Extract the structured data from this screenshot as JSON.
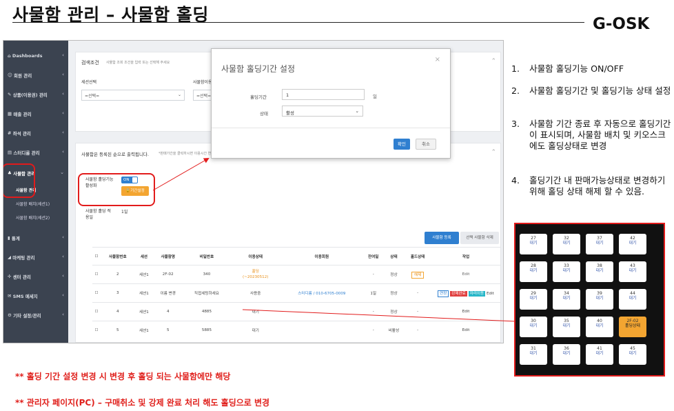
{
  "header": {
    "title": "사물함 관리 – 사물함 홀딩",
    "brand": "G-OSK"
  },
  "sidebar": {
    "items": [
      {
        "label": "Dashboards",
        "icon": "home-icon"
      },
      {
        "label": "회원 관리",
        "icon": "user-icon"
      },
      {
        "label": "상품(이용권) 관리",
        "icon": "tag-icon"
      },
      {
        "label": "매출 관리",
        "icon": "chart-icon"
      },
      {
        "label": "좌석 관리",
        "icon": "seat-icon"
      },
      {
        "label": "스터디룸 관리",
        "icon": "room-icon"
      },
      {
        "label": "사물함 관리",
        "icon": "locker-icon"
      },
      {
        "label": "통계",
        "icon": "stats-icon"
      },
      {
        "label": "마케팅 관리",
        "icon": "megaphone-icon"
      },
      {
        "label": "센터 관리",
        "icon": "center-icon"
      },
      {
        "label": "SMS 메세지",
        "icon": "sms-icon"
      },
      {
        "label": "기타 설정/관리",
        "icon": "settings-icon"
      }
    ],
    "subitems": [
      "사물함 관리",
      "사물함 배치(세션1)",
      "사물함 배치(세션2)"
    ]
  },
  "search": {
    "title": "검색조건",
    "hint": "사물함 조회 조건을 입력 또는 선택해 주세요",
    "labels": [
      "세션선택",
      "사물함이용상태",
      "상태"
    ],
    "placeholders": [
      "=선택=",
      "=선택="
    ]
  },
  "list": {
    "title": "사물함은 등록된 순으로 출력됩니다.",
    "hint": "*판매가간을 클릭하시면 이용시간 연장이",
    "holding_label": "사물함 홀딩기능 활성화",
    "toggle": "ON",
    "period_btn": "기간설정",
    "apply_label": "사물함 홀딩 적용일",
    "apply_value": "1일",
    "register_btn": "사물함 등록",
    "delete_btn": "선택 사물함 삭제",
    "columns": [
      "사물함번호",
      "세션",
      "사물함명",
      "비밀번호",
      "이용상태",
      "이용회원",
      "잔여일",
      "상태",
      "홀드상태",
      "작업"
    ],
    "rows": [
      {
        "no": "2",
        "session": "세션1",
        "name": "2F-02",
        "pw": "340",
        "use": "홀딩",
        "use2": "(~20230512)",
        "member": "",
        "remain": "-",
        "state": "정상",
        "hold": "해제",
        "actions": [
          "Edit"
        ]
      },
      {
        "no": "3",
        "session": "세션1",
        "name": "이름 변경",
        "pw": "직접세팅하세요",
        "use": "사용중",
        "use2": "",
        "member": "스터디룸 / 010-6705-0009",
        "remain": "1일",
        "state": "정상",
        "hold": "-",
        "actions": [
          "연장",
          "강제완료",
          "자리이동",
          "Edit"
        ]
      },
      {
        "no": "4",
        "session": "세션1",
        "name": "4",
        "pw": "4885",
        "use": "대기",
        "use2": "",
        "member": "",
        "remain": "-",
        "state": "정상",
        "hold": "-",
        "actions": [
          "Edit"
        ]
      },
      {
        "no": "5",
        "session": "세션1",
        "name": "5",
        "pw": "5885",
        "use": "대기",
        "use2": "",
        "member": "",
        "remain": "-",
        "state": "비활성",
        "hold": "-",
        "actions": [
          "Edit"
        ]
      }
    ]
  },
  "modal": {
    "title": "사물함 홀딩기간 설정",
    "close": "×",
    "period_label": "홀딩기간",
    "period_value": "1",
    "period_unit": "일",
    "state_label": "상태",
    "state_value": "활성",
    "confirm": "확인",
    "cancel": "취소"
  },
  "notes": [
    {
      "n": "1.",
      "t": "사물함 홀딩기능 ON/OFF"
    },
    {
      "n": "2.",
      "t": "사물함 홀딩기간 및 홀딩기능 상태 설정"
    },
    {
      "n": "3.",
      "t": "사물함 기간 종료 후 자동으로 홀딩기간이 표시되며, 사물함 배치 및 키오스크에도 홀딩상태로 변경"
    },
    {
      "n": "4.",
      "t": "홀딩기간 내 판매가능상태로 변경하기위해 홀딩 상태 해제 할 수 있음."
    }
  ],
  "kiosk": {
    "cells": [
      {
        "num": "27",
        "st": "대기"
      },
      {
        "num": "32",
        "st": "대기"
      },
      {
        "num": "37",
        "st": "대기"
      },
      {
        "num": "42",
        "st": "대기"
      },
      {
        "num": "28",
        "st": "대기"
      },
      {
        "num": "33",
        "st": "대기"
      },
      {
        "num": "38",
        "st": "대기"
      },
      {
        "num": "43",
        "st": "대기"
      },
      {
        "num": "29",
        "st": "대기"
      },
      {
        "num": "34",
        "st": "대기"
      },
      {
        "num": "39",
        "st": "대기"
      },
      {
        "num": "44",
        "st": "대기"
      },
      {
        "num": "30",
        "st": "대기"
      },
      {
        "num": "35",
        "st": "대기"
      },
      {
        "num": "40",
        "st": "대기"
      },
      {
        "num": "2F-02",
        "st": "홀딩상태"
      },
      {
        "num": "31",
        "st": "대기"
      },
      {
        "num": "36",
        "st": "대기"
      },
      {
        "num": "41",
        "st": "대기"
      },
      {
        "num": "45",
        "st": "대기"
      }
    ]
  },
  "footnotes": [
    "** 홀딩 기간 설정 변경 시 변경 후 홀딩 되는 사물함에만 해당",
    "** 관리자 페이지(PC) – 구매취소 및 강제 완료 처리 해도 홀딩으로 변경"
  ],
  "colors": {
    "red": "#e21b1b",
    "sidebar": "#3b4350",
    "primary": "#2f7fd0",
    "orange": "#f3a531"
  }
}
